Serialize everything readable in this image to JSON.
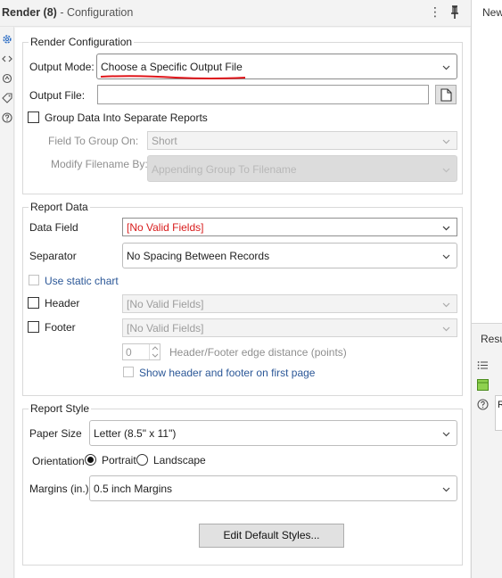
{
  "header": {
    "tool_name": "Render (8)",
    "subtitle": "- Configuration",
    "menu_glyph": "⋮"
  },
  "right_pane": {
    "top_label": "New",
    "results_label": "Resu",
    "row_label": "R"
  },
  "render_config": {
    "legend": "Render Configuration",
    "output_mode_label": "Output Mode:",
    "output_mode_value": "Choose a Specific Output File",
    "output_file_label": "Output File:",
    "output_file_value": "",
    "group_checkbox_label": "Group Data Into Separate Reports",
    "group_checked": false,
    "field_to_group_label": "Field To Group On:",
    "field_to_group_value": "Short",
    "modify_filename_label": "Modify Filename By:",
    "modify_filename_value": "Appending Group To Filename"
  },
  "report_data": {
    "legend": "Report Data",
    "data_field_label": "Data Field",
    "data_field_value": "[No Valid Fields]",
    "separator_label": "Separator",
    "separator_value": "No Spacing Between Records",
    "static_chart_label": "Use static chart",
    "header_label": "Header",
    "header_value": "[No Valid Fields]",
    "footer_label": "Footer",
    "footer_value": "[No Valid Fields]",
    "edge_distance_value": "0",
    "edge_distance_label": "Header/Footer edge distance (points)",
    "show_first_page_label": "Show header and footer on first page"
  },
  "report_style": {
    "legend": "Report Style",
    "paper_size_label": "Paper Size",
    "paper_size_value": "Letter (8.5\" x 11\")",
    "orientation_label": "Orientation",
    "portrait_label": "Portrait",
    "landscape_label": "Landscape",
    "orientation_selected": "Portrait",
    "margins_label": "Margins (in.)",
    "margins_value": "0.5 inch Margins",
    "edit_styles_button": "Edit Default Styles..."
  },
  "colors": {
    "accent_blue": "#2b5797",
    "error_red": "#d81c1c",
    "annotation_red": "#e0161b"
  },
  "icons": [
    "gear-icon",
    "code-icon",
    "cycle-icon",
    "tag-icon",
    "help-icon",
    "pin-icon",
    "list-icon",
    "table-icon",
    "file-icon",
    "chevron-down-icon"
  ]
}
